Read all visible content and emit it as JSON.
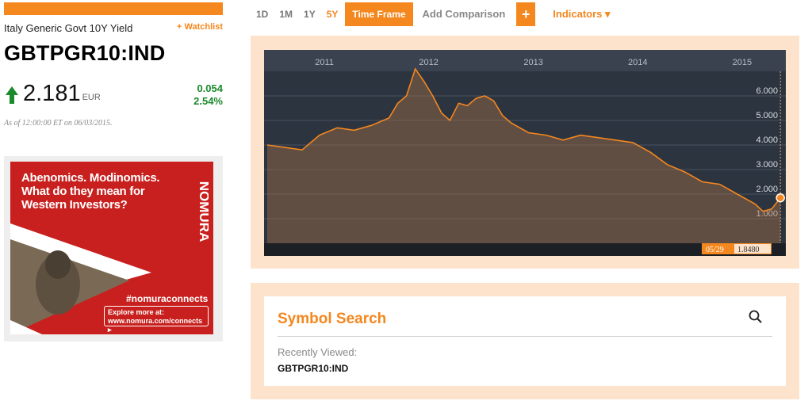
{
  "security": {
    "name": "Italy Generic Govt 10Y Yield",
    "watchlist_label": "+ Watchlist",
    "ticker": "GBTPGR10:IND",
    "price": "2.181",
    "currency": "EUR",
    "change_abs": "0.054",
    "change_pct": "2.54%",
    "as_of": "As of 12:00:00 ET on 06/03/2015.",
    "direction_icon": "up-arrow-icon"
  },
  "ad": {
    "headline": "Abenomics. Modinomics. What do they mean for Western Investors?",
    "brand": "NOMURA",
    "hashtag": "#nomuraconnects",
    "cta": "Explore more at: www.nomura.com/connects ▸"
  },
  "toolbar": {
    "ranges": [
      {
        "label": "1D",
        "active": false
      },
      {
        "label": "1M",
        "active": false
      },
      {
        "label": "1Y",
        "active": false
      },
      {
        "label": "5Y",
        "active": true
      }
    ],
    "time_frame": "Time Frame",
    "add_comparison": "Add Comparison",
    "plus": "+",
    "indicators": "Indicators ▾"
  },
  "chart_data": {
    "type": "area",
    "x_labels": [
      "2011",
      "2012",
      "2013",
      "2014",
      "2015"
    ],
    "y_ticks": [
      "1.000",
      "2.000",
      "3.000",
      "4.000",
      "5.000",
      "6.000"
    ],
    "ylim": [
      0,
      7
    ],
    "xlim": [
      "2010-06-04",
      "2015-06-03"
    ],
    "series": [
      {
        "values": [
          [
            "2010-06",
            4.0
          ],
          [
            "2010-08",
            3.9
          ],
          [
            "2010-10",
            3.8
          ],
          [
            "2010-12",
            4.4
          ],
          [
            "2011-02",
            4.7
          ],
          [
            "2011-04",
            4.6
          ],
          [
            "2011-06",
            4.8
          ],
          [
            "2011-08",
            5.1
          ],
          [
            "2011-09",
            5.7
          ],
          [
            "2011-10",
            6.0
          ],
          [
            "2011-11",
            7.1
          ],
          [
            "2011-12",
            6.6
          ],
          [
            "2012-01",
            6.0
          ],
          [
            "2012-02",
            5.3
          ],
          [
            "2012-03",
            5.0
          ],
          [
            "2012-04",
            5.7
          ],
          [
            "2012-05",
            5.6
          ],
          [
            "2012-06",
            5.9
          ],
          [
            "2012-07",
            6.0
          ],
          [
            "2012-08",
            5.8
          ],
          [
            "2012-09",
            5.2
          ],
          [
            "2012-10",
            4.9
          ],
          [
            "2012-12",
            4.5
          ],
          [
            "2013-02",
            4.4
          ],
          [
            "2013-04",
            4.2
          ],
          [
            "2013-06",
            4.4
          ],
          [
            "2013-08",
            4.3
          ],
          [
            "2013-10",
            4.2
          ],
          [
            "2013-12",
            4.1
          ],
          [
            "2014-02",
            3.7
          ],
          [
            "2014-04",
            3.2
          ],
          [
            "2014-06",
            2.9
          ],
          [
            "2014-08",
            2.5
          ],
          [
            "2014-10",
            2.4
          ],
          [
            "2014-12",
            2.0
          ],
          [
            "2015-02",
            1.6
          ],
          [
            "2015-03",
            1.3
          ],
          [
            "2015-04",
            1.4
          ],
          [
            "2015-05",
            1.848
          ]
        ]
      }
    ],
    "crosshair_date": "05/29",
    "crosshair_value": "1.8480",
    "grid": true,
    "line_color": "#f4871e"
  },
  "search": {
    "title": "Symbol Search",
    "recent_label": "Recently Viewed:",
    "recent_item": "GBTPGR10:IND"
  }
}
